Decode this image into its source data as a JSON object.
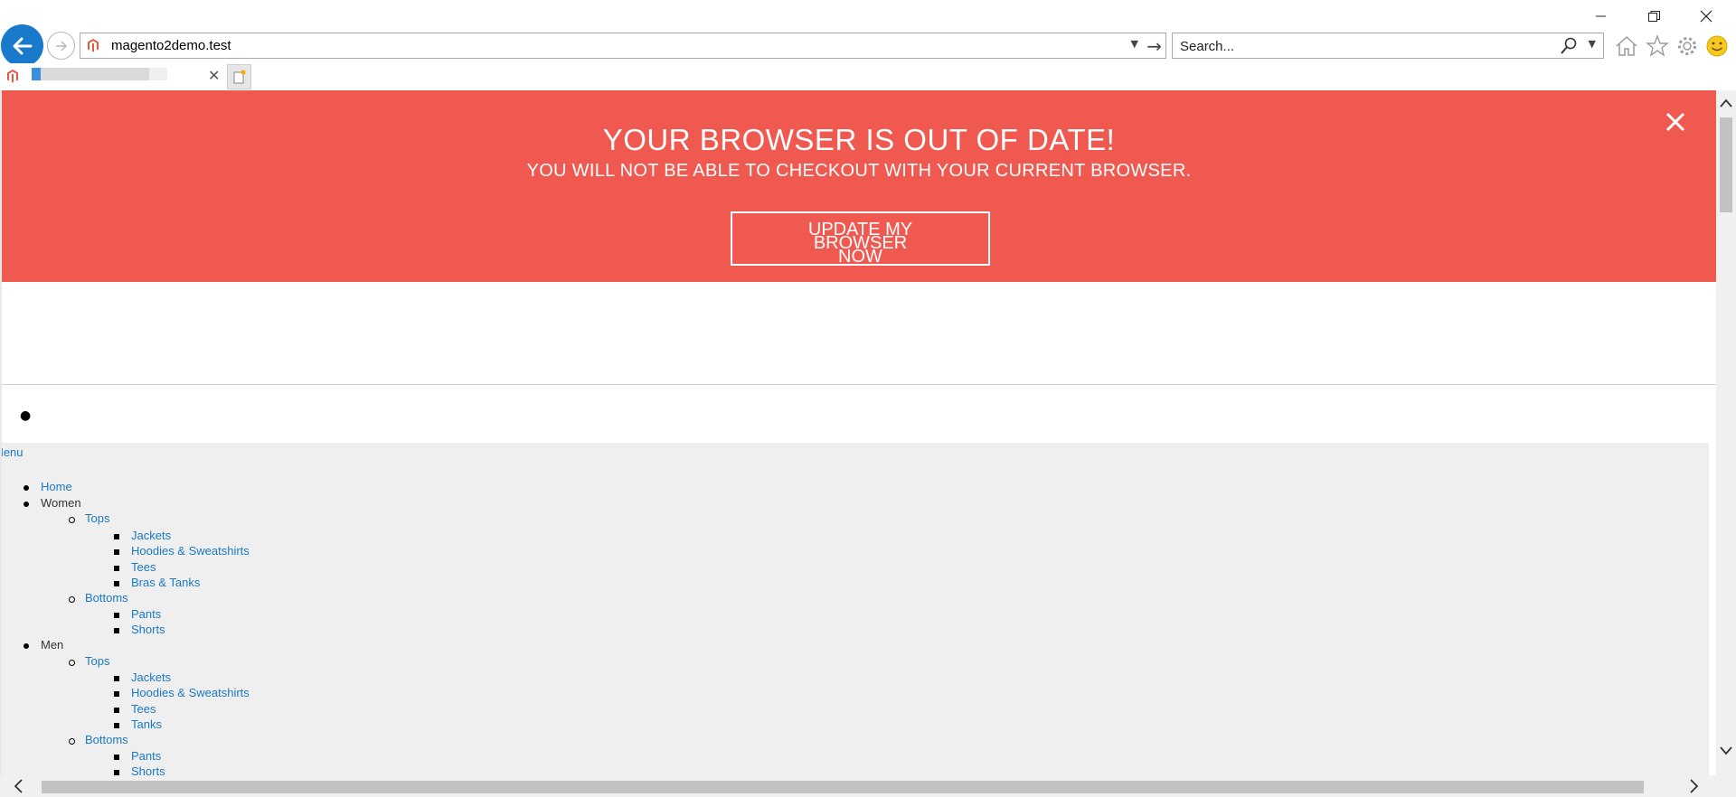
{
  "browser": {
    "address_url": "magento2demo.test",
    "search_placeholder": "Search...",
    "tab_title": ""
  },
  "banner": {
    "title": "YOUR BROWSER IS OUT OF DATE!",
    "subtitle": "YOU WILL NOT BE ABLE TO CHECKOUT WITH YOUR CURRENT BROWSER.",
    "button_line1": "UPDATE MY BROWSER",
    "button_line2": "NOW",
    "bg_color": "#f0594f"
  },
  "menu": {
    "toggle_label": "Menu",
    "items": {
      "home": "Home",
      "women": "Women",
      "women_tops": "Tops",
      "women_jackets": "Jackets",
      "women_hoodies": "Hoodies & Sweatshirts",
      "women_tees": "Tees",
      "women_bras": "Bras & Tanks",
      "women_bottoms": "Bottoms",
      "women_pants": "Pants",
      "women_shorts": "Shorts",
      "men": "Men",
      "men_tops": "Tops",
      "men_jackets": "Jackets",
      "men_hoodies": "Hoodies & Sweatshirts",
      "men_tees": "Tees",
      "men_tanks": "Tanks",
      "men_bottoms": "Bottoms",
      "men_pants": "Pants",
      "men_shorts": "Shorts"
    },
    "link_color": "#1979c3"
  }
}
